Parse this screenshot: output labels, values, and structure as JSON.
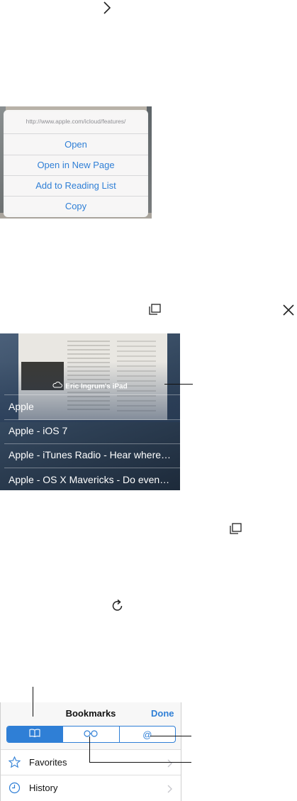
{
  "context_menu": {
    "url": "http://www.apple.com/icloud/features/",
    "items": [
      "Open",
      "Open in New Page",
      "Add to Reading List",
      "Copy"
    ]
  },
  "icloud_tabs": {
    "device": "Eric Ingrum's iPad",
    "rows": [
      "Apple",
      "Apple - iOS 7",
      "Apple - iTunes Radio - Hear where…",
      "Apple - OS X Mavericks - Do even…"
    ]
  },
  "bookmarks": {
    "title": "Bookmarks",
    "done_label": "Done",
    "segments": [
      "bookmarks-icon",
      "reading-list-icon",
      "shared-links-icon"
    ],
    "rows": [
      {
        "label": "Favorites",
        "icon": "star-icon"
      },
      {
        "label": "History",
        "icon": "clock-icon"
      }
    ]
  },
  "icons": [
    "chevron-right-icon",
    "tabs-icon",
    "close-icon",
    "reload-icon"
  ],
  "colors": {
    "accent": "#2f7fd6"
  }
}
